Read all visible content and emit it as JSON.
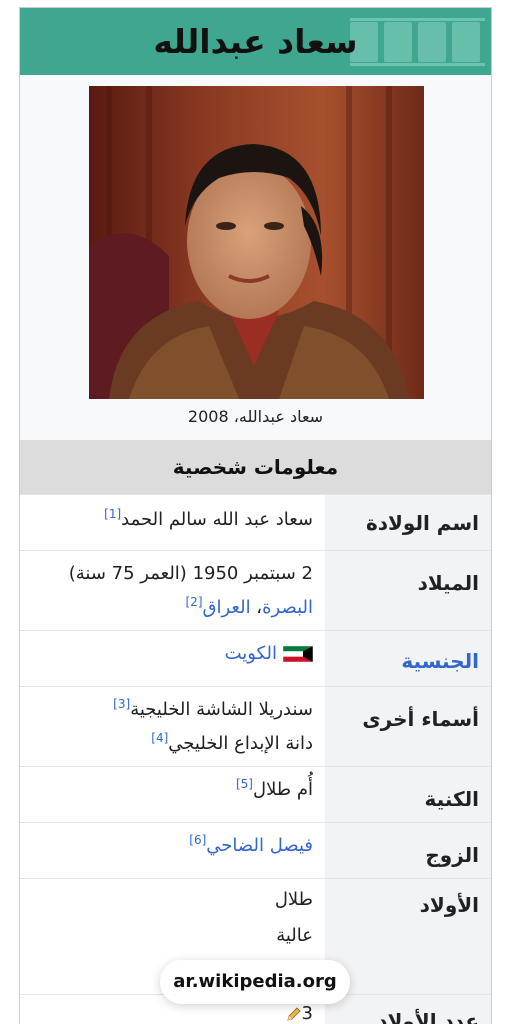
{
  "title": "سعاد عبدالله",
  "image": {
    "caption": "سعاد عبدالله، 2008"
  },
  "section_header": "معلومات شخصية",
  "rows": [
    {
      "label": "اسم الولادة",
      "lines": [
        {
          "text": "سعاد عبد الله سالم الحمد",
          "ref": "[1]"
        }
      ]
    },
    {
      "label": "الميلاد",
      "lines": [
        {
          "text": "2 سبتمبر 1950 (العمر 75 سنة)"
        },
        {
          "link1": "البصرة",
          "sep": "، ",
          "link2": "العراق",
          "ref": "[2]"
        }
      ]
    },
    {
      "label": "الجنسية",
      "lines": [
        {
          "text": "الكويت",
          "icon": "kuwait-flag-icon"
        }
      ]
    },
    {
      "label": "أسماء أخرى",
      "lines": [
        {
          "text": "سندريلا الشاشة الخليجية",
          "ref": "[3]"
        },
        {
          "text": "دانة الإبداع الخليجي",
          "ref": "[4]"
        }
      ]
    },
    {
      "label": "الكنية",
      "lines": [
        {
          "text": "أُم طلال",
          "ref": "[5]"
        }
      ]
    },
    {
      "label": "الزوج",
      "lines": [
        {
          "text": "فيصل الضاحي",
          "ref": "[6]"
        }
      ]
    },
    {
      "label": "الأولاد",
      "lines": [
        {
          "text": "طلال"
        },
        {
          "text": "عالية"
        }
      ]
    },
    {
      "label": "عدد الأولاد",
      "lines": [
        {
          "text": "3",
          "icon": "pencil-icon"
        }
      ]
    }
  ],
  "browser": {
    "url": "ar.wikipedia.org"
  },
  "colors": {
    "title_bg": "#3fa68f",
    "section_bg": "#dcdcdc",
    "label_bg": "#f2f3f5",
    "link": "#3366cc"
  }
}
